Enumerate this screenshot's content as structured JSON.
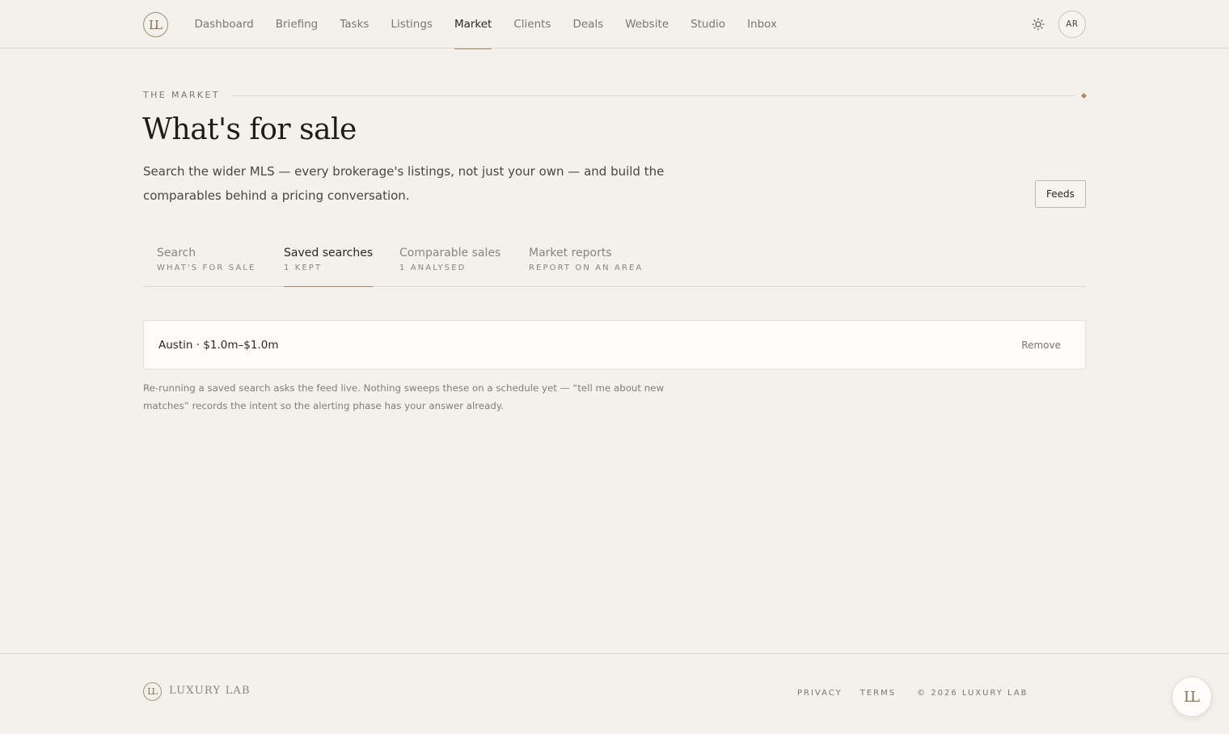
{
  "brand": {
    "monogram": "LL",
    "name": "LUXURY LAB"
  },
  "nav": {
    "items": [
      {
        "label": "Dashboard",
        "active": false
      },
      {
        "label": "Briefing",
        "active": false
      },
      {
        "label": "Tasks",
        "active": false
      },
      {
        "label": "Listings",
        "active": false
      },
      {
        "label": "Market",
        "active": true
      },
      {
        "label": "Clients",
        "active": false
      },
      {
        "label": "Deals",
        "active": false
      },
      {
        "label": "Website",
        "active": false
      },
      {
        "label": "Studio",
        "active": false
      },
      {
        "label": "Inbox",
        "active": false
      }
    ],
    "theme_icon": "sun-icon",
    "avatar_initials": "AR"
  },
  "page": {
    "eyebrow": "THE MARKET",
    "title": "What's for sale",
    "lede": "Search the wider MLS — every brokerage's listings, not just your own — and build the comparables behind a pricing conversation.",
    "feeds_label": "Feeds"
  },
  "tabs": [
    {
      "label": "Search",
      "sub": "WHAT'S FOR SALE",
      "active": false
    },
    {
      "label": "Saved searches",
      "sub": "1 KEPT",
      "active": true
    },
    {
      "label": "Comparable sales",
      "sub": "1 ANALYSED",
      "active": false
    },
    {
      "label": "Market reports",
      "sub": "REPORT ON AN AREA",
      "active": false
    }
  ],
  "saved_searches": [
    {
      "name": "Austin · $1.0m–$1.0m",
      "remove_label": "Remove"
    }
  ],
  "helper_note": "Re-running a saved search asks the feed live. Nothing sweeps these on a schedule yet — “tell me about new matches” records the intent so the alerting phase has your answer already.",
  "footer": {
    "links": [
      "PRIVACY",
      "TERMS"
    ],
    "copyright": "© 2026 LUXURY LAB"
  },
  "colors": {
    "background": "#f3f1ec",
    "accent": "#a88a67",
    "text": "#2b2722",
    "muted": "#7b766e"
  }
}
